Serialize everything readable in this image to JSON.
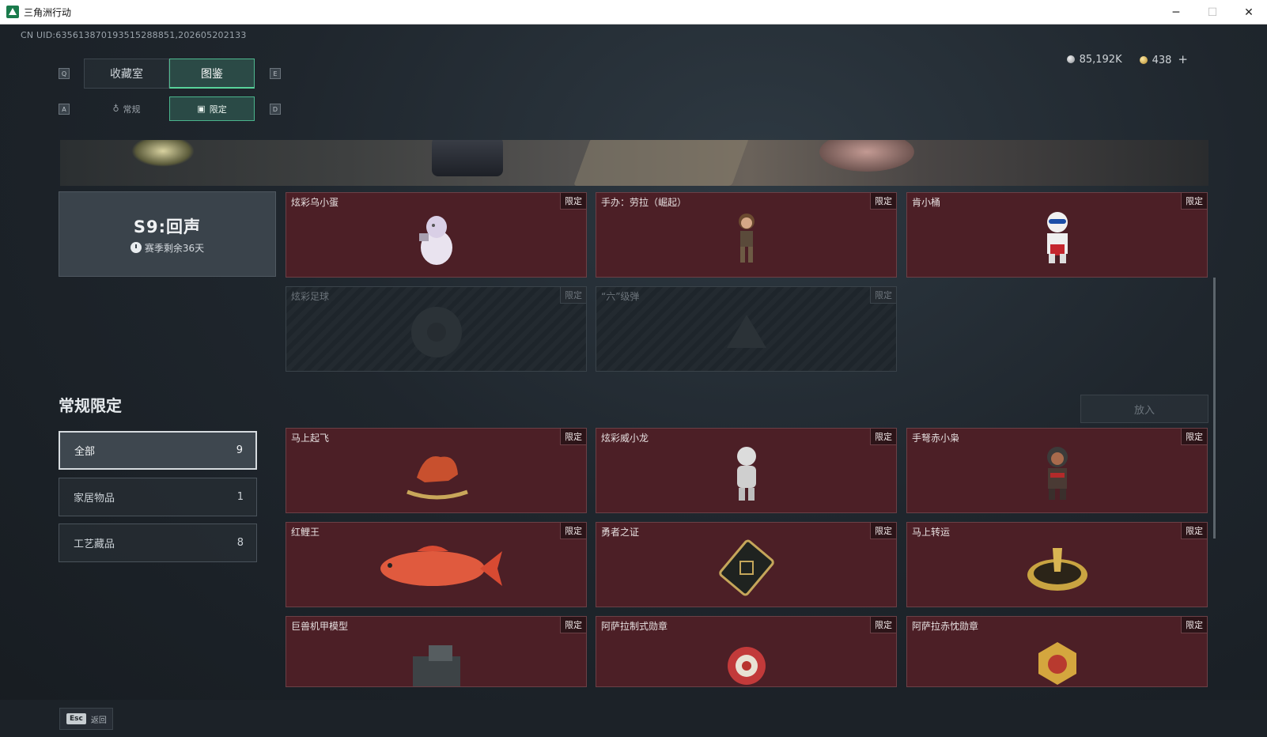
{
  "window": {
    "title": "三角洲行动",
    "minimize_glyph": "─",
    "maximize_glyph": "☐",
    "close_glyph": "✕"
  },
  "uid_text": "CN UID:635613870193515288851,202605202133",
  "currency": {
    "silver": "85,192K",
    "gold": "438",
    "plus": "+"
  },
  "nav": {
    "key_left": "Q",
    "key_right": "E",
    "tabs": [
      "收藏室",
      "图鉴"
    ],
    "active_tab": "图鉴",
    "sub_key_left": "A",
    "sub_key_right": "D",
    "sub_tabs": [
      "常规",
      "限定"
    ],
    "active_sub_tab": "限定"
  },
  "season": {
    "title": "S9:回声",
    "remaining": "赛季剩余36天"
  },
  "season_items": [
    {
      "name": "炫彩乌小蛋",
      "badge": "限定",
      "locked": false,
      "icon": "egg-figure-icon"
    },
    {
      "name": "手办：劳拉（崛起）",
      "badge": "限定",
      "locked": false,
      "icon": "lara-figure-icon"
    },
    {
      "name": "肯小桶",
      "badge": "限定",
      "locked": false,
      "icon": "colonel-figure-icon"
    },
    {
      "name": "炫彩足球",
      "badge": "限定",
      "locked": true,
      "icon": "football-icon"
    },
    {
      "name": "“六”级弹",
      "badge": "限定",
      "locked": true,
      "icon": "bullet-icon"
    }
  ],
  "section": {
    "title": "常规限定",
    "place_button": "放入"
  },
  "filters": [
    {
      "label": "全部",
      "count": "9",
      "active": true
    },
    {
      "label": "家居物品",
      "count": "1",
      "active": false
    },
    {
      "label": "工艺藏品",
      "count": "8",
      "active": false
    }
  ],
  "regular_items": [
    {
      "name": "马上起飞",
      "badge": "限定",
      "icon": "rocking-horse-icon"
    },
    {
      "name": "炫彩威小龙",
      "badge": "限定",
      "icon": "dragon-figure-icon"
    },
    {
      "name": "手弩赤小枭",
      "badge": "限定",
      "icon": "hooded-figure-icon"
    },
    {
      "name": "红鲤王",
      "badge": "限定",
      "icon": "carp-icon"
    },
    {
      "name": "勇者之证",
      "badge": "限定",
      "icon": "card-badge-icon"
    },
    {
      "name": "马上转运",
      "badge": "限定",
      "icon": "wheel-icon"
    },
    {
      "name": "巨兽机甲模型",
      "badge": "限定",
      "icon": "mech-model-icon"
    },
    {
      "name": "阿萨拉制式勋章",
      "badge": "限定",
      "icon": "medal-icon"
    },
    {
      "name": "阿萨拉赤忱勋章",
      "badge": "限定",
      "icon": "gold-medal-icon"
    }
  ],
  "footer": {
    "esc_key": "Esc",
    "back_label": "返回"
  }
}
